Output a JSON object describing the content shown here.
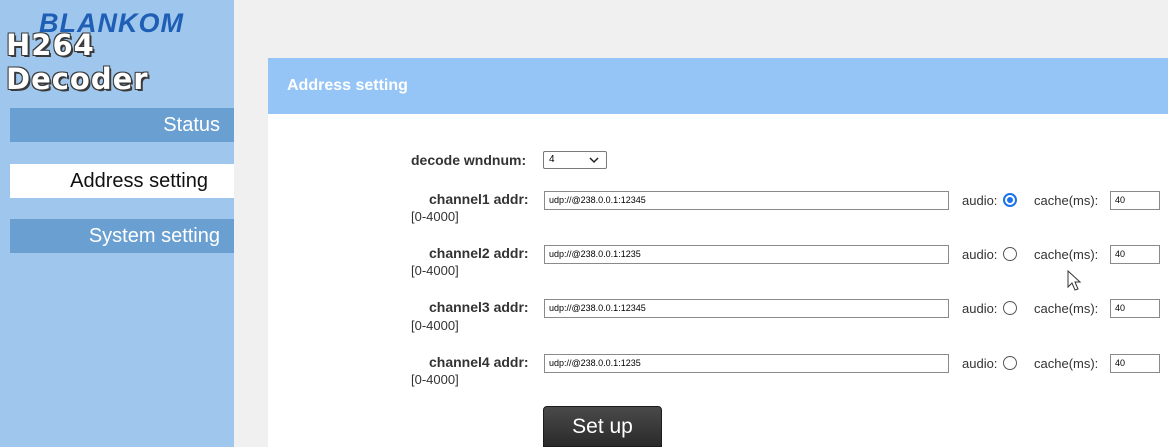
{
  "logo": {
    "brand": "BLANKOM",
    "product": "H264 Decoder"
  },
  "nav": {
    "items": [
      {
        "label": "Status",
        "active": false
      },
      {
        "label": "Address setting",
        "active": true
      },
      {
        "label": "System setting",
        "active": false
      }
    ]
  },
  "panel": {
    "title": "Address setting",
    "decode_label": "decode wndnum:",
    "decode_value": "4",
    "audio_label": "audio:",
    "cache_label": "cache(ms):",
    "range_label": "[0-4000]",
    "channels": [
      {
        "label": "channel1 addr:",
        "addr": "udp://@238.0.0.1:12345",
        "audio_selected": true,
        "cache": "40"
      },
      {
        "label": "channel2 addr:",
        "addr": "udp://@238.0.0.1:1235",
        "audio_selected": false,
        "cache": "40"
      },
      {
        "label": "channel3 addr:",
        "addr": "udp://@238.0.0.1:12345",
        "audio_selected": false,
        "cache": "40"
      },
      {
        "label": "channel4 addr:",
        "addr": "udp://@238.0.0.1:1235",
        "audio_selected": false,
        "cache": "40"
      }
    ],
    "setup_label": "Set up"
  },
  "colors": {
    "sidebar_bg": "#9fc6ec",
    "nav_inactive": "#6a9fd2",
    "panel_header": "#95c5f6",
    "radio_selected": "#1a73e8"
  }
}
